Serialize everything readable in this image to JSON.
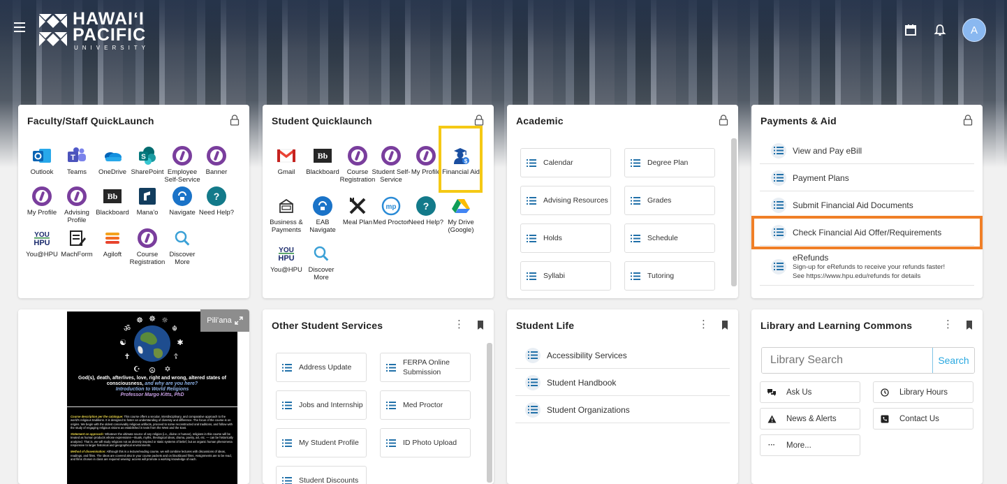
{
  "header": {
    "logo_line1": "HAWAIʻI",
    "logo_line2": "PACIFIC",
    "logo_line3": "UNIVERSITY",
    "avatar_initial": "A"
  },
  "faculty_quicklaunch": {
    "title": "Faculty/Staff QuickLaunch",
    "items": [
      {
        "label": "Outlook",
        "icon": "outlook-icon"
      },
      {
        "label": "Teams",
        "icon": "teams-icon"
      },
      {
        "label": "OneDrive",
        "icon": "onedrive-icon"
      },
      {
        "label": "SharePoint",
        "icon": "sharepoint-icon"
      },
      {
        "label": "Employee Self-Service",
        "icon": "hpu-icon"
      },
      {
        "label": "Banner",
        "icon": "hpu-icon"
      },
      {
        "label": "My Profile",
        "icon": "hpu-icon"
      },
      {
        "label": "Advising Profile",
        "icon": "hpu-icon"
      },
      {
        "label": "Blackboard",
        "icon": "blackboard-icon"
      },
      {
        "label": "Mana'o",
        "icon": "manao-icon"
      },
      {
        "label": "Navigate",
        "icon": "navigate-icon"
      },
      {
        "label": "Need Help?",
        "icon": "help-icon"
      },
      {
        "label": "You@HPU",
        "icon": "you-hpu-icon"
      },
      {
        "label": "MachForm",
        "icon": "machform-icon"
      },
      {
        "label": "Agiloft",
        "icon": "agiloft-icon"
      },
      {
        "label": "Course Registration",
        "icon": "hpu-icon"
      },
      {
        "label": "Discover More",
        "icon": "discover-icon"
      }
    ]
  },
  "student_quicklaunch": {
    "title": "Student Quicklaunch",
    "items": [
      {
        "label": "Gmail",
        "icon": "gmail-icon"
      },
      {
        "label": "Blackboard",
        "icon": "blackboard-icon"
      },
      {
        "label": "Course Registration",
        "icon": "hpu-icon"
      },
      {
        "label": "Student Self-Service",
        "icon": "hpu-icon"
      },
      {
        "label": "My Profile",
        "icon": "hpu-icon"
      },
      {
        "label": "Financial Aid",
        "icon": "financial-aid-icon"
      },
      {
        "label": "Business & Payments",
        "icon": "business-payments-icon"
      },
      {
        "label": "EAB Navigate",
        "icon": "navigate-icon"
      },
      {
        "label": "Meal Plan",
        "icon": "meal-plan-icon"
      },
      {
        "label": "Med Proctor",
        "icon": "med-proctor-icon"
      },
      {
        "label": "Need Help?",
        "icon": "help-icon"
      },
      {
        "label": "My Drive (Google)",
        "icon": "google-drive-icon"
      },
      {
        "label": "You@HPU",
        "icon": "you-hpu-icon"
      },
      {
        "label": "Discover More",
        "icon": "discover-icon"
      }
    ]
  },
  "academic": {
    "title": "Academic",
    "tiles": [
      "Calendar",
      "Degree Plan",
      "Advising Resources",
      "Grades",
      "Holds",
      "Schedule",
      "Syllabi",
      "Tutoring"
    ]
  },
  "payments_aid": {
    "title": "Payments & Aid",
    "rows": [
      {
        "label": "View and Pay eBill"
      },
      {
        "label": "Payment Plans"
      },
      {
        "label": "Submit Financial Aid Documents"
      },
      {
        "label": "Check Financial Aid Offer/Requirements"
      }
    ],
    "erefunds": {
      "label": "eRefunds",
      "line1": "Sign-up for eRefunds to receive your refunds faster!",
      "line2": "See https://www.hpu.edu/refunds for details"
    }
  },
  "pili_ana": {
    "label": "Piliʻana",
    "poster_title_line1": "God(s), death, afterlives, love, right and wrong, altered states of",
    "poster_title_line2a": "consciousness, ",
    "poster_title_line2b": "and why are you here?",
    "poster_subtitle": "Introduction to World Religions",
    "poster_author": "Professor Margo Kitts, PhD",
    "p1_lead": "Course description per the catalogue:",
    "p1_text": " This course offers a secular, interdisciplinary, and comparative approach to the world's religious traditions. It is designed to foster an understanding of diversity and difference. The focus of the course is on origins. We begin with the oldest conceivably religious artifacts, proceed to some reconstructed oral traditions, and follow with the study of engaging religious visions as established in texts from the West and the East.",
    "p2_lead": "Statement on approach:",
    "p2_text": " Whatever the ultimate source of any religion (i.e., divine or human), religions in this course will be treated as human products whose expressions—rituals, myths, theological ideas, drama, poetry, art, etc. — can be historically analyzed. That is, we will study religions not as divinely inspired or static systems of belief, but as organic human phenomena responsive to larger historical and geographical environments.",
    "p3_lead": "Method of dissemination:",
    "p3_text": " Although this is a lecture/reading course, we will combine lectures with discussions of ideas, readings, and films. The ideas are covered also in your course packets and on blackboard films. Assignments are to be read, and films chosen in class are required viewing: access will promote a working knowledge of each."
  },
  "other_services": {
    "title": "Other Student Services",
    "tiles": [
      "Address Update",
      "FERPA Online Submission",
      "Jobs and Internship",
      "Med Proctor",
      "My Student Profile",
      "ID Photo Upload",
      "Student Discounts"
    ]
  },
  "student_life": {
    "title": "Student Life",
    "rows": [
      "Accessibility Services",
      "Student Handbook",
      "Student Organizations"
    ]
  },
  "library": {
    "title": "Library and Learning Commons",
    "search_placeholder": "Library Search",
    "search_button": "Search",
    "buttons": [
      "Ask Us",
      "Library Hours",
      "News & Alerts",
      "Contact Us",
      "More..."
    ]
  },
  "colors": {
    "accent_blue": "#29a8e0",
    "highlight_yellow": "#f5c915",
    "highlight_orange": "#f07f27",
    "hpu_purple": "#7a3e9d"
  }
}
